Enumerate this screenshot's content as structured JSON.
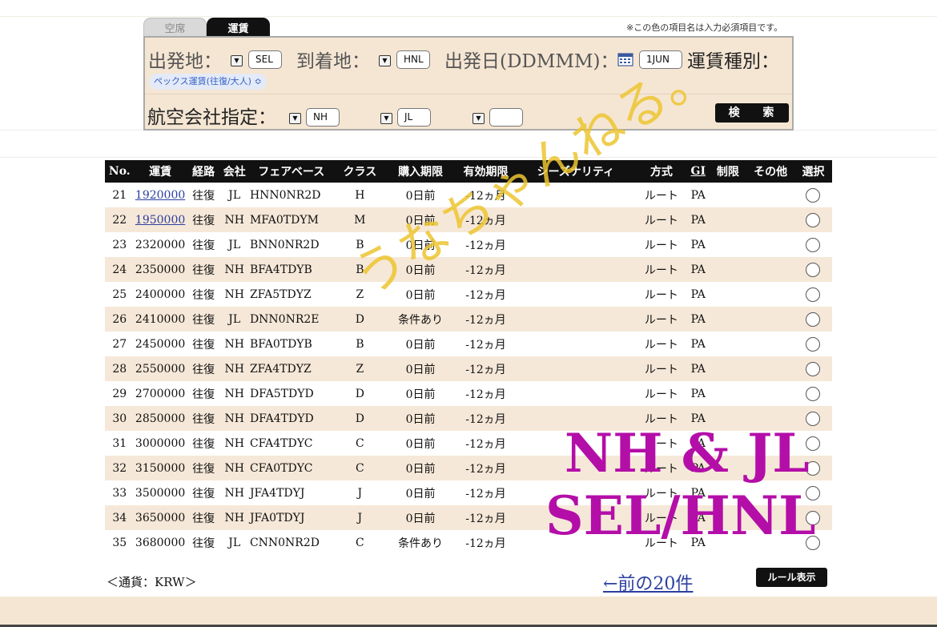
{
  "tabs": [
    {
      "label": "空席",
      "active": false
    },
    {
      "label": "運賃",
      "active": true
    }
  ],
  "required_note": "※この色の項目名は入力必須項目です。",
  "search": {
    "origin_label": "出発地：",
    "origin_value": "SEL",
    "dest_label": "到着地：",
    "dest_value": "HNL",
    "date_label": "出発日(DDMMM)：",
    "date_value": "1JUN",
    "fare_type_label": "運賃種別：",
    "fare_type_value": "ペックス運賃(往復/大人) ≎",
    "airline_label": "航空会社指定：",
    "airline_1": "NH",
    "airline_2": "JL",
    "airline_3": "",
    "search_button": "検 索",
    "dropdown_icon": "▼"
  },
  "table": {
    "headers": [
      "No.",
      "運賃",
      "経路",
      "会社",
      "フェアベース",
      "クラス",
      "購入期限",
      "有効期限",
      "シーズナリティ",
      "方式",
      "GI",
      "制限",
      "その他",
      "選択"
    ],
    "rows": [
      {
        "no": "21",
        "fare": "1920000",
        "link": true,
        "route": "往復",
        "co": "JL",
        "base": "HNN0NR2D",
        "cls": "H",
        "buy": "0日前",
        "valid": "-12ヵ月",
        "season": "",
        "method": "ルート",
        "gi": "PA",
        "limit": "",
        "other": ""
      },
      {
        "no": "22",
        "fare": "1950000",
        "link": true,
        "route": "往復",
        "co": "NH",
        "base": "MFA0TDYM",
        "cls": "M",
        "buy": "0日前",
        "valid": "-12ヵ月",
        "season": "",
        "method": "ルート",
        "gi": "PA",
        "limit": "",
        "other": ""
      },
      {
        "no": "23",
        "fare": "2320000",
        "link": false,
        "route": "往復",
        "co": "JL",
        "base": "BNN0NR2D",
        "cls": "B",
        "buy": "0日前",
        "valid": "-12ヵ月",
        "season": "",
        "method": "ルート",
        "gi": "PA",
        "limit": "",
        "other": ""
      },
      {
        "no": "24",
        "fare": "2350000",
        "link": false,
        "route": "往復",
        "co": "NH",
        "base": "BFA4TDYB",
        "cls": "B",
        "buy": "0日前",
        "valid": "-12ヵ月",
        "season": "",
        "method": "ルート",
        "gi": "PA",
        "limit": "",
        "other": ""
      },
      {
        "no": "25",
        "fare": "2400000",
        "link": false,
        "route": "往復",
        "co": "NH",
        "base": "ZFA5TDYZ",
        "cls": "Z",
        "buy": "0日前",
        "valid": "-12ヵ月",
        "season": "",
        "method": "ルート",
        "gi": "PA",
        "limit": "",
        "other": ""
      },
      {
        "no": "26",
        "fare": "2410000",
        "link": false,
        "route": "往復",
        "co": "JL",
        "base": "DNN0NR2E",
        "cls": "D",
        "buy": "条件あり",
        "valid": "-12ヵ月",
        "season": "",
        "method": "ルート",
        "gi": "PA",
        "limit": "",
        "other": ""
      },
      {
        "no": "27",
        "fare": "2450000",
        "link": false,
        "route": "往復",
        "co": "NH",
        "base": "BFA0TDYB",
        "cls": "B",
        "buy": "0日前",
        "valid": "-12ヵ月",
        "season": "",
        "method": "ルート",
        "gi": "PA",
        "limit": "",
        "other": ""
      },
      {
        "no": "28",
        "fare": "2550000",
        "link": false,
        "route": "往復",
        "co": "NH",
        "base": "ZFA4TDYZ",
        "cls": "Z",
        "buy": "0日前",
        "valid": "-12ヵ月",
        "season": "",
        "method": "ルート",
        "gi": "PA",
        "limit": "",
        "other": ""
      },
      {
        "no": "29",
        "fare": "2700000",
        "link": false,
        "route": "往復",
        "co": "NH",
        "base": "DFA5TDYD",
        "cls": "D",
        "buy": "0日前",
        "valid": "-12ヵ月",
        "season": "",
        "method": "ルート",
        "gi": "PA",
        "limit": "",
        "other": ""
      },
      {
        "no": "30",
        "fare": "2850000",
        "link": false,
        "route": "往復",
        "co": "NH",
        "base": "DFA4TDYD",
        "cls": "D",
        "buy": "0日前",
        "valid": "-12ヵ月",
        "season": "",
        "method": "ルート",
        "gi": "PA",
        "limit": "",
        "other": ""
      },
      {
        "no": "31",
        "fare": "3000000",
        "link": false,
        "route": "往復",
        "co": "NH",
        "base": "CFA4TDYC",
        "cls": "C",
        "buy": "0日前",
        "valid": "-12ヵ月",
        "season": "",
        "method": "ルート",
        "gi": "PA",
        "limit": "",
        "other": ""
      },
      {
        "no": "32",
        "fare": "3150000",
        "link": false,
        "route": "往復",
        "co": "NH",
        "base": "CFA0TDYC",
        "cls": "C",
        "buy": "0日前",
        "valid": "-12ヵ月",
        "season": "",
        "method": "ルート",
        "gi": "PA",
        "limit": "",
        "other": ""
      },
      {
        "no": "33",
        "fare": "3500000",
        "link": false,
        "route": "往復",
        "co": "NH",
        "base": "JFA4TDYJ",
        "cls": "J",
        "buy": "0日前",
        "valid": "-12ヵ月",
        "season": "",
        "method": "ルート",
        "gi": "PA",
        "limit": "",
        "other": ""
      },
      {
        "no": "34",
        "fare": "3650000",
        "link": false,
        "route": "往復",
        "co": "NH",
        "base": "JFA0TDYJ",
        "cls": "J",
        "buy": "0日前",
        "valid": "-12ヵ月",
        "season": "",
        "method": "ルート",
        "gi": "PA",
        "limit": "",
        "other": ""
      },
      {
        "no": "35",
        "fare": "3680000",
        "link": false,
        "route": "往復",
        "co": "JL",
        "base": "CNN0NR2D",
        "cls": "C",
        "buy": "条件あり",
        "valid": "-12ヵ月",
        "season": "",
        "method": "ルート",
        "gi": "PA",
        "limit": "",
        "other": ""
      }
    ]
  },
  "footer": {
    "currency": "＜通貨：KRW＞",
    "prev_link": "←前の20件",
    "rule_button": "ルール表示"
  },
  "overlays": {
    "watermark": "うなちゃんねる。",
    "caption_line1": "NH & JL",
    "caption_line2": "SEL/HNL",
    "watermark_color": "#ecc430",
    "caption_color": "#b40ea8"
  },
  "colors": {
    "panel_bg": "#f5e6d3",
    "row_alt_bg": "#f6e8d8",
    "header_bg": "#111111",
    "link": "#2b3fa0"
  }
}
